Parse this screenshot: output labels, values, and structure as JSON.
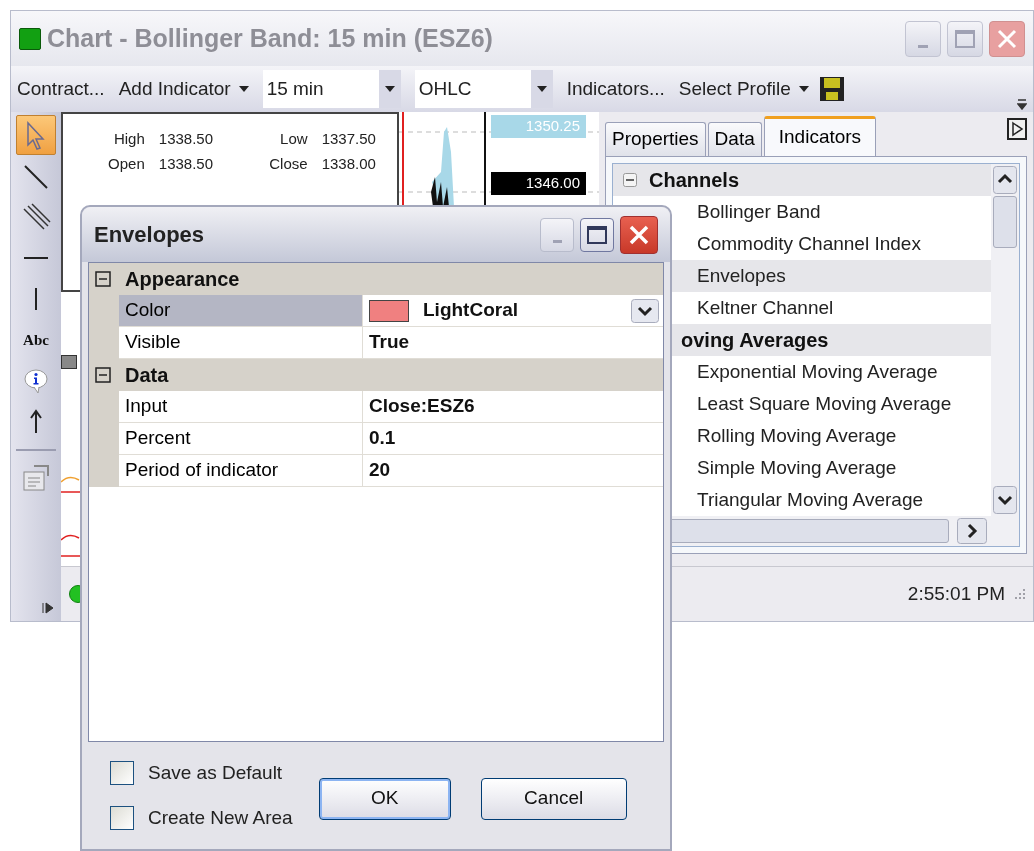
{
  "window": {
    "title": "Chart - Bollinger Band: 15 min (ESZ6)"
  },
  "toolbar": [
    {
      "kind": "button",
      "label": "Contract..."
    },
    {
      "kind": "menu",
      "label": "Add Indicator"
    },
    {
      "kind": "combo",
      "value": "15 min"
    },
    {
      "kind": "combo",
      "value": "OHLC"
    },
    {
      "kind": "button",
      "label": "Indicators..."
    },
    {
      "kind": "menu",
      "label": "Select Profile"
    }
  ],
  "tools": [
    {
      "kind": "pointer",
      "selected": true
    },
    {
      "kind": "line",
      "selected": false
    },
    {
      "kind": "channel",
      "selected": false
    },
    {
      "kind": "hline",
      "selected": false
    },
    {
      "kind": "vline",
      "selected": false
    },
    {
      "kind": "text",
      "label": "Abc",
      "selected": false
    },
    {
      "kind": "info",
      "selected": false
    },
    {
      "kind": "arrow",
      "selected": false
    },
    {
      "kind": "properties",
      "selected": false
    }
  ],
  "chart": {
    "quote": [
      {
        "label": "High",
        "value": "1338.50"
      },
      {
        "label": "Low",
        "value": "1337.50"
      },
      {
        "label": "Open",
        "value": "1338.50"
      },
      {
        "label": "Close",
        "value": "1338.00"
      }
    ],
    "price_labels": [
      {
        "kind": "high",
        "value": "1350.25"
      },
      {
        "kind": "last",
        "value": "1346.00"
      }
    ]
  },
  "panel": {
    "tabs": [
      {
        "label": "Properties",
        "selected": false
      },
      {
        "label": "Data",
        "selected": false
      },
      {
        "label": "Indicators",
        "selected": true
      }
    ],
    "groups": [
      {
        "label": "Channels",
        "expanded": true,
        "children": [
          {
            "label": "Bollinger Band",
            "selected": false
          },
          {
            "label": "Commodity Channel Index",
            "selected": false
          },
          {
            "label": "Envelopes",
            "selected": true
          },
          {
            "label": "Keltner Channel",
            "selected": false
          }
        ]
      },
      {
        "label": "oving Averages",
        "children": [
          {
            "label": "Exponential Moving Average",
            "selected": false
          },
          {
            "label": "Least Square Moving Average",
            "selected": false
          },
          {
            "label": "Rolling Moving Average",
            "selected": false
          },
          {
            "label": "Simple Moving Average",
            "selected": false
          },
          {
            "label": "Triangular Moving Average",
            "selected": false
          }
        ]
      }
    ]
  },
  "status_bar": {
    "time": "2:55:01 PM"
  },
  "dialog": {
    "title": "Envelopes",
    "categories": [
      {
        "label": "Appearance",
        "expanded": true,
        "properties": [
          {
            "name": "Color",
            "value": "LightCoral",
            "color": "#f08080",
            "selected": true
          },
          {
            "name": "Visible",
            "value": "True",
            "selected": false
          }
        ]
      },
      {
        "label": "Data",
        "expanded": true,
        "properties": [
          {
            "name": "Input",
            "value": "Close:ESZ6",
            "selected": false
          },
          {
            "name": "Percent",
            "value": "0.1",
            "selected": false
          },
          {
            "name": "Period of indicator",
            "value": "20",
            "selected": false
          }
        ]
      }
    ],
    "checkboxes": [
      {
        "label": "Save as Default",
        "checked": false
      },
      {
        "label": "Create New Area",
        "checked": false
      }
    ],
    "buttons": [
      "OK",
      "Cancel"
    ]
  }
}
